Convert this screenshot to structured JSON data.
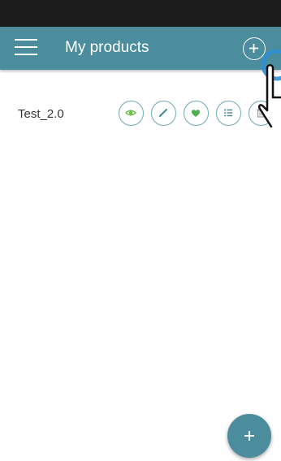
{
  "app_bar": {
    "title": "My products",
    "background_color": "#4b8d9c",
    "menu_icon": "hamburger-menu-icon",
    "add_icon": "plus-circle-icon"
  },
  "status_bar": {
    "background_color": "#1b1b1b"
  },
  "products": [
    {
      "name": "Test_2.0",
      "actions": [
        {
          "name": "view",
          "icon": "eye-icon",
          "color": "#6cc04a"
        },
        {
          "name": "edit",
          "icon": "pencil-icon",
          "color": "#4b8d9c"
        },
        {
          "name": "favorite",
          "icon": "heart-icon",
          "color": "#4caf50"
        },
        {
          "name": "details",
          "icon": "list-icon",
          "color": "#4b8d9c"
        },
        {
          "name": "delete",
          "icon": "trash-icon",
          "color": "#9e9e9e"
        }
      ]
    }
  ],
  "fab": {
    "icon": "plus-icon",
    "color": "#4b8d9c"
  },
  "overlay": {
    "tap_indicator_icon": "tap-ripple-icon",
    "hand_icon": "pointing-hand-icon",
    "tap_color": "#2e8fd1"
  }
}
